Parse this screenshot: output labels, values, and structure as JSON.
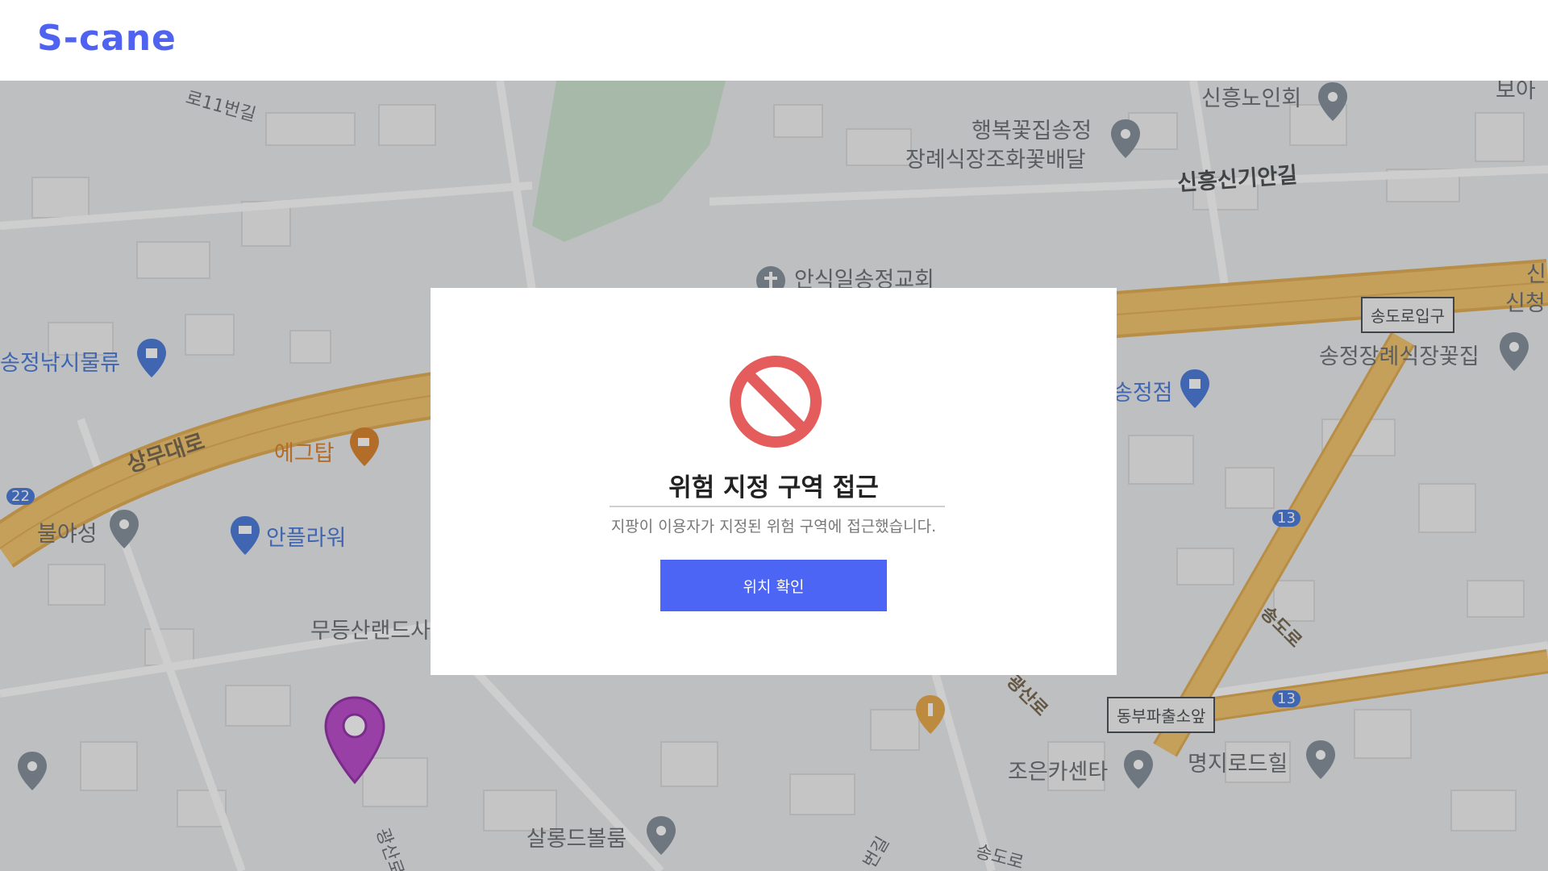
{
  "header": {
    "logo_text": "S-cane"
  },
  "map": {
    "labels": {
      "road_11beon": "로11번길",
      "sinheung_senior": "신흥노인회",
      "haengbok_line1": "행복꽃집송정",
      "haengbok_line2": "장례식장조화꽃배달",
      "sinheung_sinan": "신흥신기안길",
      "ansikil_church": "안식일송정교회",
      "songjeong_fishing": "송정낚시물류",
      "sangmu_daero": "상무대로",
      "egg_top": "에그탑",
      "bulyaseong": "불야성",
      "anflower": "안플라워",
      "mudeungsan": "무등산랜드사",
      "songjeong_store": "송정점",
      "songjeong_funeral_flower": "송정장례식장꽃집",
      "right_edge_top": "보아",
      "right_edge_sin1": "신",
      "right_edge_sin2": "신청",
      "gwangsan_ro": "광산로",
      "songdo_ro": "송도로",
      "joeun_car": "조은카센타",
      "myeongji_road": "명지로드힐",
      "salon_de_bolum": "살롱드볼룸",
      "songdo_ro_bottom": "송도로",
      "beon_gil_bottom": "번길",
      "gwangsan_bottom": "광산로"
    },
    "road_boxes": {
      "songdo_entrance": "송도로입구",
      "dongbu_police": "동부파출소앞"
    },
    "route_badges": {
      "r22": "22",
      "r13a": "13",
      "r13b": "13"
    },
    "user_marker_color": "#b63bc9"
  },
  "modal": {
    "icon": "prohibited-icon",
    "title": "위험 지정 구역 접근",
    "message": "지팡이 이용자가 지정된 위험 구역에 접근했습니다.",
    "button_label": "위치 확인",
    "accent_color": "#4d65f5",
    "icon_color": "#e45c5c"
  }
}
